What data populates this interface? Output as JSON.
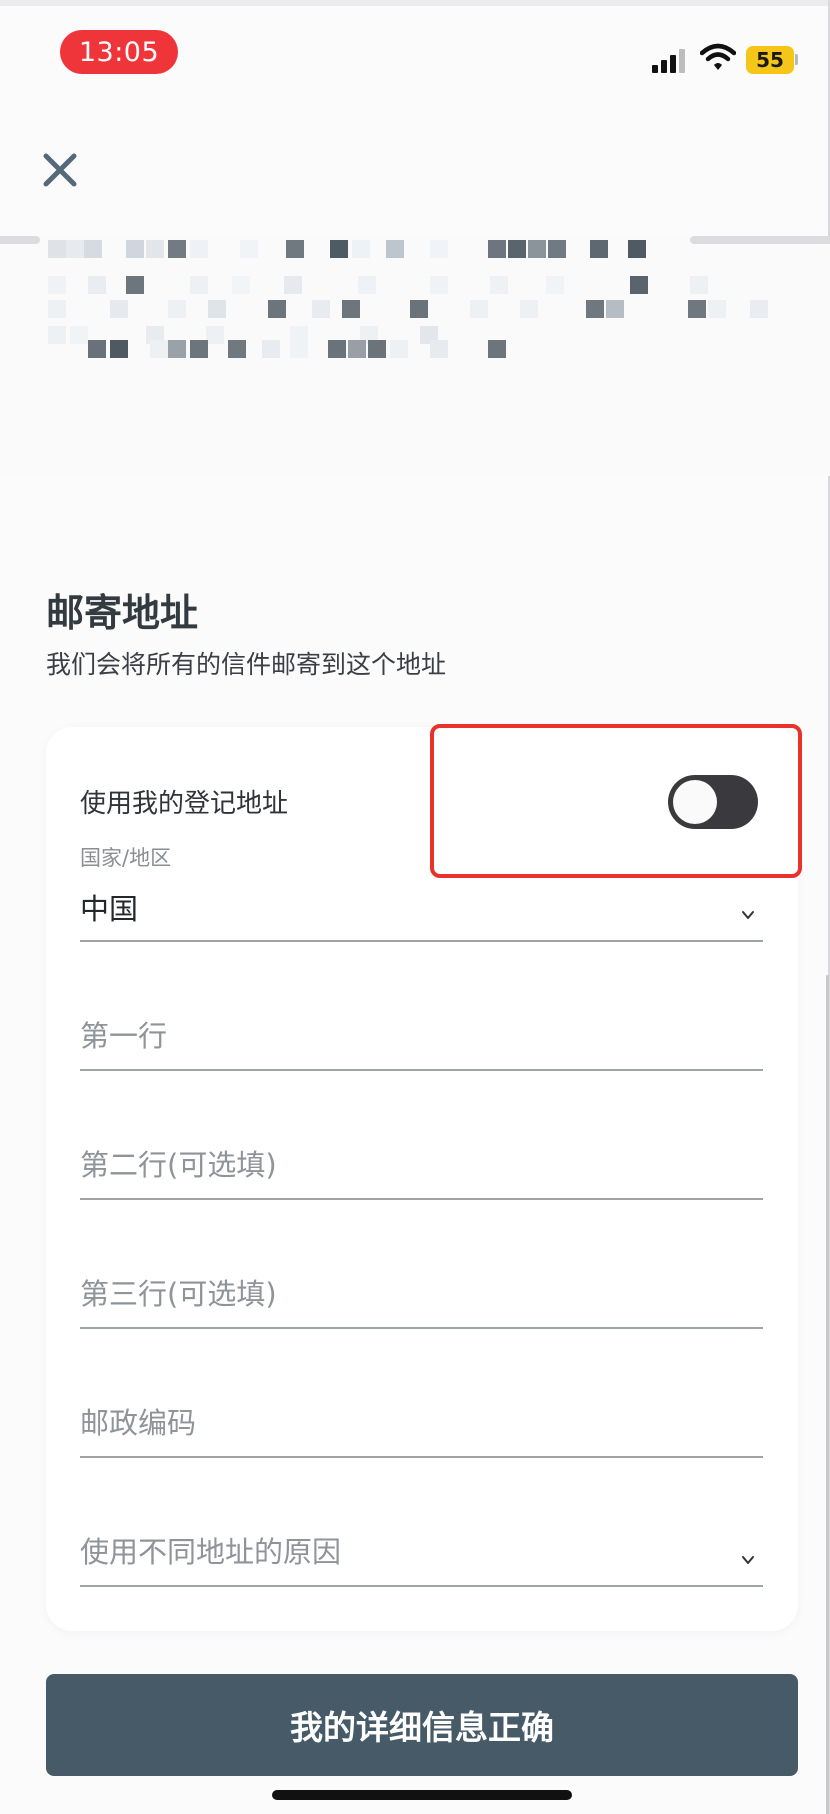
{
  "status_bar": {
    "time": "13:05",
    "battery": "55"
  },
  "icons": {
    "close": "close-icon",
    "signal": "signal-icon",
    "wifi": "wifi-icon",
    "chevron": "chevron-down-icon"
  },
  "section": {
    "title": "邮寄地址",
    "subtitle": "我们会将所有的信件邮寄到这个地址"
  },
  "form": {
    "use_registered_address_label": "使用我的登记地址",
    "use_registered_address_on": false,
    "country_label": "国家/地区",
    "country_value": "中国",
    "line1_placeholder": "第一行",
    "line2_placeholder": "第二行(可选填)",
    "line3_placeholder": "第三行(可选填)",
    "postcode_placeholder": "邮政编码",
    "reason_placeholder": "使用不同地址的原因"
  },
  "confirm_button": "我的详细信息正确",
  "colors": {
    "accent": "#465a68",
    "time_pill": "#f0353a",
    "highlight": "#e8322b",
    "battery": "#f5c518"
  }
}
